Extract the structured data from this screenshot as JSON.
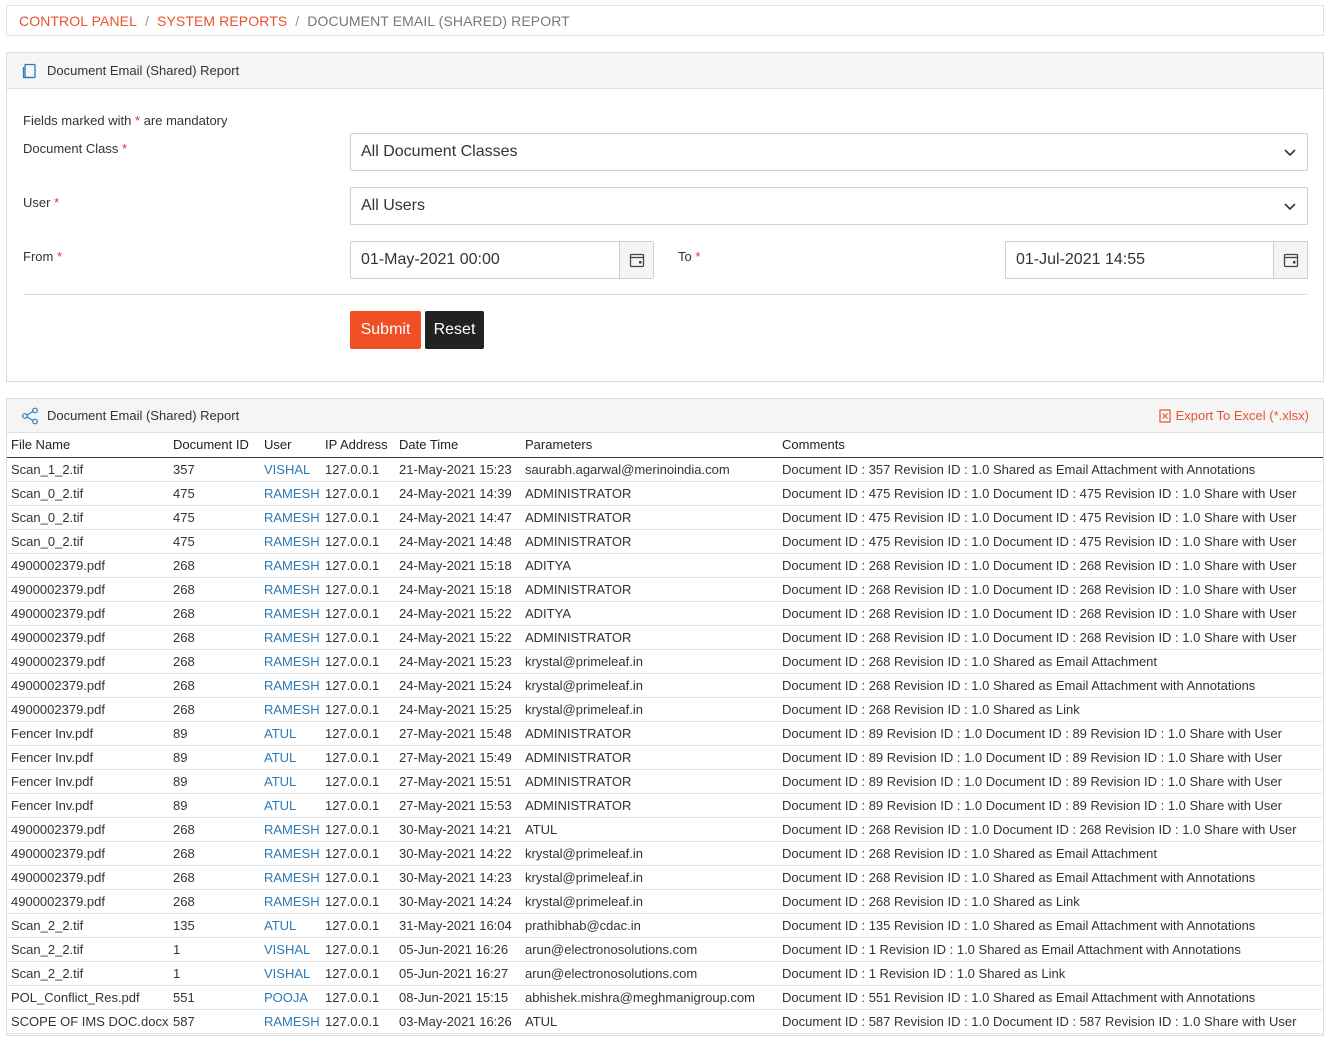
{
  "breadcrumb": {
    "control_panel": "CONTROL PANEL",
    "system_reports": "SYSTEM REPORTS",
    "current": "DOCUMENT EMAIL (SHARED) REPORT",
    "sep": "/"
  },
  "form": {
    "title": "Document Email (Shared) Report",
    "mandatory_prefix": "Fields marked with",
    "mandatory_suffix": "are mandatory",
    "star": "*",
    "doc_class_label": "Document Class",
    "doc_class_value": "All Document Classes",
    "user_label": "User",
    "user_value": "All Users",
    "from_label": "From",
    "from_value": "01-May-2021 00:00",
    "to_label": "To",
    "to_value": "01-Jul-2021 14:55",
    "submit": "Submit",
    "reset": "Reset"
  },
  "report": {
    "title": "Document Email (Shared) Report",
    "export": "Export To Excel (*.xlsx)",
    "columns": [
      "File Name",
      "Document ID",
      "User",
      "IP Address",
      "Date Time",
      "Parameters",
      "Comments"
    ],
    "rows": [
      [
        "Scan_1_2.tif",
        "357",
        "VISHAL",
        "127.0.0.1",
        "21-May-2021 15:23",
        "saurabh.agarwal@merinoindia.com",
        "Document ID : 357 Revision ID : 1.0 Shared as Email Attachment with Annotations"
      ],
      [
        "Scan_0_2.tif",
        "475",
        "RAMESH",
        "127.0.0.1",
        "24-May-2021 14:39",
        "ADMINISTRATOR",
        "Document ID : 475 Revision ID : 1.0 Document ID : 475 Revision ID : 1.0 Share with User"
      ],
      [
        "Scan_0_2.tif",
        "475",
        "RAMESH",
        "127.0.0.1",
        "24-May-2021 14:47",
        "ADMINISTRATOR",
        "Document ID : 475 Revision ID : 1.0 Document ID : 475 Revision ID : 1.0 Share with User"
      ],
      [
        "Scan_0_2.tif",
        "475",
        "RAMESH",
        "127.0.0.1",
        "24-May-2021 14:48",
        "ADMINISTRATOR",
        "Document ID : 475 Revision ID : 1.0 Document ID : 475 Revision ID : 1.0 Share with User"
      ],
      [
        "4900002379.pdf",
        "268",
        "RAMESH",
        "127.0.0.1",
        "24-May-2021 15:18",
        "ADITYA",
        "Document ID : 268 Revision ID : 1.0 Document ID : 268 Revision ID : 1.0 Share with User"
      ],
      [
        "4900002379.pdf",
        "268",
        "RAMESH",
        "127.0.0.1",
        "24-May-2021 15:18",
        "ADMINISTRATOR",
        "Document ID : 268 Revision ID : 1.0 Document ID : 268 Revision ID : 1.0 Share with User"
      ],
      [
        "4900002379.pdf",
        "268",
        "RAMESH",
        "127.0.0.1",
        "24-May-2021 15:22",
        "ADITYA",
        "Document ID : 268 Revision ID : 1.0 Document ID : 268 Revision ID : 1.0 Share with User"
      ],
      [
        "4900002379.pdf",
        "268",
        "RAMESH",
        "127.0.0.1",
        "24-May-2021 15:22",
        "ADMINISTRATOR",
        "Document ID : 268 Revision ID : 1.0 Document ID : 268 Revision ID : 1.0 Share with User"
      ],
      [
        "4900002379.pdf",
        "268",
        "RAMESH",
        "127.0.0.1",
        "24-May-2021 15:23",
        "krystal@primeleaf.in",
        "Document ID : 268 Revision ID : 1.0 Shared as Email Attachment"
      ],
      [
        "4900002379.pdf",
        "268",
        "RAMESH",
        "127.0.0.1",
        "24-May-2021 15:24",
        "krystal@primeleaf.in",
        "Document ID : 268 Revision ID : 1.0 Shared as Email Attachment with Annotations"
      ],
      [
        "4900002379.pdf",
        "268",
        "RAMESH",
        "127.0.0.1",
        "24-May-2021 15:25",
        "krystal@primeleaf.in",
        "Document ID : 268 Revision ID : 1.0 Shared as Link"
      ],
      [
        "Fencer Inv.pdf",
        "89",
        "ATUL",
        "127.0.0.1",
        "27-May-2021 15:48",
        "ADMINISTRATOR",
        "Document ID : 89 Revision ID : 1.0 Document ID : 89 Revision ID : 1.0 Share with User"
      ],
      [
        "Fencer Inv.pdf",
        "89",
        "ATUL",
        "127.0.0.1",
        "27-May-2021 15:49",
        "ADMINISTRATOR",
        "Document ID : 89 Revision ID : 1.0 Document ID : 89 Revision ID : 1.0 Share with User"
      ],
      [
        "Fencer Inv.pdf",
        "89",
        "ATUL",
        "127.0.0.1",
        "27-May-2021 15:51",
        "ADMINISTRATOR",
        "Document ID : 89 Revision ID : 1.0 Document ID : 89 Revision ID : 1.0 Share with User"
      ],
      [
        "Fencer Inv.pdf",
        "89",
        "ATUL",
        "127.0.0.1",
        "27-May-2021 15:53",
        "ADMINISTRATOR",
        "Document ID : 89 Revision ID : 1.0 Document ID : 89 Revision ID : 1.0 Share with User"
      ],
      [
        "4900002379.pdf",
        "268",
        "RAMESH",
        "127.0.0.1",
        "30-May-2021 14:21",
        "ATUL",
        "Document ID : 268 Revision ID : 1.0 Document ID : 268 Revision ID : 1.0 Share with User"
      ],
      [
        "4900002379.pdf",
        "268",
        "RAMESH",
        "127.0.0.1",
        "30-May-2021 14:22",
        "krystal@primeleaf.in",
        "Document ID : 268 Revision ID : 1.0 Shared as Email Attachment"
      ],
      [
        "4900002379.pdf",
        "268",
        "RAMESH",
        "127.0.0.1",
        "30-May-2021 14:23",
        "krystal@primeleaf.in",
        "Document ID : 268 Revision ID : 1.0 Shared as Email Attachment with Annotations"
      ],
      [
        "4900002379.pdf",
        "268",
        "RAMESH",
        "127.0.0.1",
        "30-May-2021 14:24",
        "krystal@primeleaf.in",
        "Document ID : 268 Revision ID : 1.0 Shared as Link"
      ],
      [
        "Scan_2_2.tif",
        "135",
        "ATUL",
        "127.0.0.1",
        "31-May-2021 16:04",
        "prathibhab@cdac.in",
        "Document ID : 135 Revision ID : 1.0 Shared as Email Attachment with Annotations"
      ],
      [
        "Scan_2_2.tif",
        "1",
        "VISHAL",
        "127.0.0.1",
        "05-Jun-2021 16:26",
        "arun@electronosolutions.com",
        "Document ID : 1 Revision ID : 1.0 Shared as Email Attachment with Annotations"
      ],
      [
        "Scan_2_2.tif",
        "1",
        "VISHAL",
        "127.0.0.1",
        "05-Jun-2021 16:27",
        "arun@electronosolutions.com",
        "Document ID : 1 Revision ID : 1.0 Shared as Link"
      ],
      [
        "POL_Conflict_Res.pdf",
        "551",
        "POOJA",
        "127.0.0.1",
        "08-Jun-2021 15:15",
        "abhishek.mishra@meghmanigroup.com",
        "Document ID : 551 Revision ID : 1.0 Shared as Email Attachment with Annotations"
      ],
      [
        "SCOPE OF IMS DOC.docx",
        "587",
        "RAMESH",
        "127.0.0.1",
        "03-May-2021 16:26",
        "ATUL",
        "Document ID : 587 Revision ID : 1.0 Document ID : 587 Revision ID : 1.0 Share with User"
      ]
    ]
  }
}
